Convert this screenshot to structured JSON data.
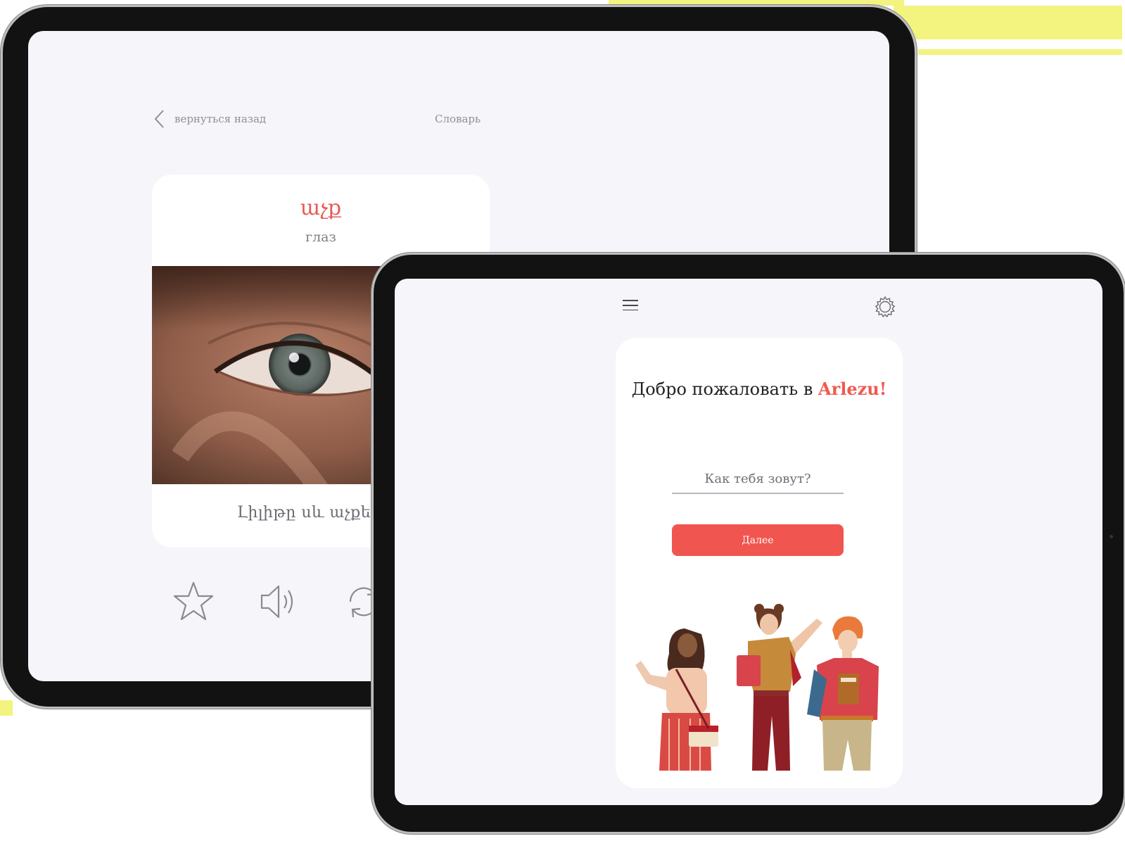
{
  "back_tablet": {
    "nav": {
      "back_label": "вернуться назад",
      "dictionary_label": "Словарь"
    },
    "card": {
      "word_armenian": "աչք",
      "word_russian": "глаз",
      "example_sentence": "Լիլիթը սև աչքեր ու"
    },
    "actions": [
      "star-icon",
      "speaker-icon",
      "repeat-icon"
    ]
  },
  "front_tablet": {
    "header": {
      "menu_icon": "hamburger-menu-icon",
      "settings_icon": "gear-icon"
    },
    "welcome": {
      "text": "Добро пожаловать в ",
      "brand": "Arlezu!"
    },
    "name_input": {
      "placeholder": "Как тебя зовут?",
      "value": ""
    },
    "next_button": "Далее"
  },
  "colors": {
    "accent": "#f0564f",
    "brand_text": "#ef5a50",
    "screen_bg": "#f5f5fa",
    "card_bg": "#ffffff",
    "highlight": "#f3f37f"
  }
}
